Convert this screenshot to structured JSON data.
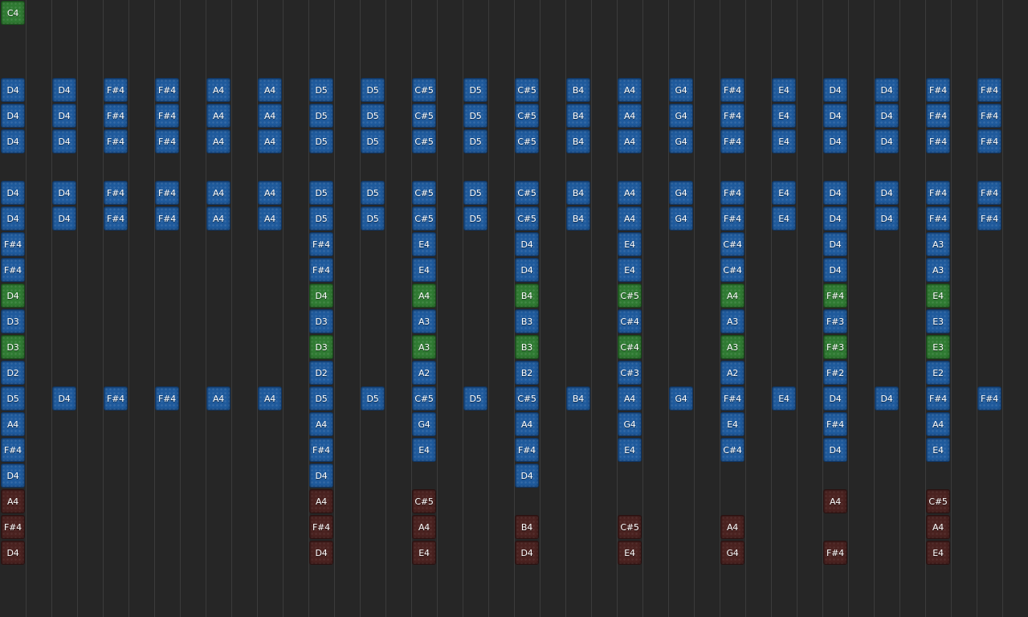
{
  "colors": {
    "background": "#262626",
    "grid_line": "#3b3b3b",
    "blue_note": "#1f5a9c",
    "green_note": "#2f7a32",
    "red_note": "#4a2220",
    "label": "#ffffff"
  },
  "columns": 20,
  "rows": 24,
  "notes": [
    {
      "col": 0,
      "row": 0,
      "label": "C4",
      "color": "green"
    },
    {
      "col": 0,
      "row": 3,
      "label": "D4",
      "color": "blue"
    },
    {
      "col": 1,
      "row": 3,
      "label": "D4",
      "color": "blue"
    },
    {
      "col": 2,
      "row": 3,
      "label": "F#4",
      "color": "blue"
    },
    {
      "col": 3,
      "row": 3,
      "label": "F#4",
      "color": "blue"
    },
    {
      "col": 4,
      "row": 3,
      "label": "A4",
      "color": "blue"
    },
    {
      "col": 5,
      "row": 3,
      "label": "A4",
      "color": "blue"
    },
    {
      "col": 6,
      "row": 3,
      "label": "D5",
      "color": "blue"
    },
    {
      "col": 7,
      "row": 3,
      "label": "D5",
      "color": "blue"
    },
    {
      "col": 8,
      "row": 3,
      "label": "C#5",
      "color": "blue"
    },
    {
      "col": 9,
      "row": 3,
      "label": "D5",
      "color": "blue"
    },
    {
      "col": 10,
      "row": 3,
      "label": "C#5",
      "color": "blue"
    },
    {
      "col": 11,
      "row": 3,
      "label": "B4",
      "color": "blue"
    },
    {
      "col": 12,
      "row": 3,
      "label": "A4",
      "color": "blue"
    },
    {
      "col": 13,
      "row": 3,
      "label": "G4",
      "color": "blue"
    },
    {
      "col": 14,
      "row": 3,
      "label": "F#4",
      "color": "blue"
    },
    {
      "col": 15,
      "row": 3,
      "label": "E4",
      "color": "blue"
    },
    {
      "col": 16,
      "row": 3,
      "label": "D4",
      "color": "blue"
    },
    {
      "col": 17,
      "row": 3,
      "label": "D4",
      "color": "blue"
    },
    {
      "col": 18,
      "row": 3,
      "label": "F#4",
      "color": "blue"
    },
    {
      "col": 19,
      "row": 3,
      "label": "F#4",
      "color": "blue"
    },
    {
      "col": 0,
      "row": 4,
      "label": "D4",
      "color": "blue"
    },
    {
      "col": 1,
      "row": 4,
      "label": "D4",
      "color": "blue"
    },
    {
      "col": 2,
      "row": 4,
      "label": "F#4",
      "color": "blue"
    },
    {
      "col": 3,
      "row": 4,
      "label": "F#4",
      "color": "blue"
    },
    {
      "col": 4,
      "row": 4,
      "label": "A4",
      "color": "blue"
    },
    {
      "col": 5,
      "row": 4,
      "label": "A4",
      "color": "blue"
    },
    {
      "col": 6,
      "row": 4,
      "label": "D5",
      "color": "blue"
    },
    {
      "col": 7,
      "row": 4,
      "label": "D5",
      "color": "blue"
    },
    {
      "col": 8,
      "row": 4,
      "label": "C#5",
      "color": "blue"
    },
    {
      "col": 9,
      "row": 4,
      "label": "D5",
      "color": "blue"
    },
    {
      "col": 10,
      "row": 4,
      "label": "C#5",
      "color": "blue"
    },
    {
      "col": 11,
      "row": 4,
      "label": "B4",
      "color": "blue"
    },
    {
      "col": 12,
      "row": 4,
      "label": "A4",
      "color": "blue"
    },
    {
      "col": 13,
      "row": 4,
      "label": "G4",
      "color": "blue"
    },
    {
      "col": 14,
      "row": 4,
      "label": "F#4",
      "color": "blue"
    },
    {
      "col": 15,
      "row": 4,
      "label": "E4",
      "color": "blue"
    },
    {
      "col": 16,
      "row": 4,
      "label": "D4",
      "color": "blue"
    },
    {
      "col": 17,
      "row": 4,
      "label": "D4",
      "color": "blue"
    },
    {
      "col": 18,
      "row": 4,
      "label": "F#4",
      "color": "blue"
    },
    {
      "col": 19,
      "row": 4,
      "label": "F#4",
      "color": "blue"
    },
    {
      "col": 0,
      "row": 5,
      "label": "D4",
      "color": "blue"
    },
    {
      "col": 1,
      "row": 5,
      "label": "D4",
      "color": "blue"
    },
    {
      "col": 2,
      "row": 5,
      "label": "F#4",
      "color": "blue"
    },
    {
      "col": 3,
      "row": 5,
      "label": "F#4",
      "color": "blue"
    },
    {
      "col": 4,
      "row": 5,
      "label": "A4",
      "color": "blue"
    },
    {
      "col": 5,
      "row": 5,
      "label": "A4",
      "color": "blue"
    },
    {
      "col": 6,
      "row": 5,
      "label": "D5",
      "color": "blue"
    },
    {
      "col": 7,
      "row": 5,
      "label": "D5",
      "color": "blue"
    },
    {
      "col": 8,
      "row": 5,
      "label": "C#5",
      "color": "blue"
    },
    {
      "col": 9,
      "row": 5,
      "label": "D5",
      "color": "blue"
    },
    {
      "col": 10,
      "row": 5,
      "label": "C#5",
      "color": "blue"
    },
    {
      "col": 11,
      "row": 5,
      "label": "B4",
      "color": "blue"
    },
    {
      "col": 12,
      "row": 5,
      "label": "A4",
      "color": "blue"
    },
    {
      "col": 13,
      "row": 5,
      "label": "G4",
      "color": "blue"
    },
    {
      "col": 14,
      "row": 5,
      "label": "F#4",
      "color": "blue"
    },
    {
      "col": 15,
      "row": 5,
      "label": "E4",
      "color": "blue"
    },
    {
      "col": 16,
      "row": 5,
      "label": "D4",
      "color": "blue"
    },
    {
      "col": 17,
      "row": 5,
      "label": "D4",
      "color": "blue"
    },
    {
      "col": 18,
      "row": 5,
      "label": "F#4",
      "color": "blue"
    },
    {
      "col": 19,
      "row": 5,
      "label": "F#4",
      "color": "blue"
    },
    {
      "col": 0,
      "row": 7,
      "label": "D4",
      "color": "blue"
    },
    {
      "col": 1,
      "row": 7,
      "label": "D4",
      "color": "blue"
    },
    {
      "col": 2,
      "row": 7,
      "label": "F#4",
      "color": "blue"
    },
    {
      "col": 3,
      "row": 7,
      "label": "F#4",
      "color": "blue"
    },
    {
      "col": 4,
      "row": 7,
      "label": "A4",
      "color": "blue"
    },
    {
      "col": 5,
      "row": 7,
      "label": "A4",
      "color": "blue"
    },
    {
      "col": 6,
      "row": 7,
      "label": "D5",
      "color": "blue"
    },
    {
      "col": 7,
      "row": 7,
      "label": "D5",
      "color": "blue"
    },
    {
      "col": 8,
      "row": 7,
      "label": "C#5",
      "color": "blue"
    },
    {
      "col": 9,
      "row": 7,
      "label": "D5",
      "color": "blue"
    },
    {
      "col": 10,
      "row": 7,
      "label": "C#5",
      "color": "blue"
    },
    {
      "col": 11,
      "row": 7,
      "label": "B4",
      "color": "blue"
    },
    {
      "col": 12,
      "row": 7,
      "label": "A4",
      "color": "blue"
    },
    {
      "col": 13,
      "row": 7,
      "label": "G4",
      "color": "blue"
    },
    {
      "col": 14,
      "row": 7,
      "label": "F#4",
      "color": "blue"
    },
    {
      "col": 15,
      "row": 7,
      "label": "E4",
      "color": "blue"
    },
    {
      "col": 16,
      "row": 7,
      "label": "D4",
      "color": "blue"
    },
    {
      "col": 17,
      "row": 7,
      "label": "D4",
      "color": "blue"
    },
    {
      "col": 18,
      "row": 7,
      "label": "F#4",
      "color": "blue"
    },
    {
      "col": 19,
      "row": 7,
      "label": "F#4",
      "color": "blue"
    },
    {
      "col": 0,
      "row": 8,
      "label": "D4",
      "color": "blue"
    },
    {
      "col": 1,
      "row": 8,
      "label": "D4",
      "color": "blue"
    },
    {
      "col": 2,
      "row": 8,
      "label": "F#4",
      "color": "blue"
    },
    {
      "col": 3,
      "row": 8,
      "label": "F#4",
      "color": "blue"
    },
    {
      "col": 4,
      "row": 8,
      "label": "A4",
      "color": "blue"
    },
    {
      "col": 5,
      "row": 8,
      "label": "A4",
      "color": "blue"
    },
    {
      "col": 6,
      "row": 8,
      "label": "D5",
      "color": "blue"
    },
    {
      "col": 7,
      "row": 8,
      "label": "D5",
      "color": "blue"
    },
    {
      "col": 8,
      "row": 8,
      "label": "C#5",
      "color": "blue"
    },
    {
      "col": 9,
      "row": 8,
      "label": "D5",
      "color": "blue"
    },
    {
      "col": 10,
      "row": 8,
      "label": "C#5",
      "color": "blue"
    },
    {
      "col": 11,
      "row": 8,
      "label": "B4",
      "color": "blue"
    },
    {
      "col": 12,
      "row": 8,
      "label": "A4",
      "color": "blue"
    },
    {
      "col": 13,
      "row": 8,
      "label": "G4",
      "color": "blue"
    },
    {
      "col": 14,
      "row": 8,
      "label": "F#4",
      "color": "blue"
    },
    {
      "col": 15,
      "row": 8,
      "label": "E4",
      "color": "blue"
    },
    {
      "col": 16,
      "row": 8,
      "label": "D4",
      "color": "blue"
    },
    {
      "col": 17,
      "row": 8,
      "label": "D4",
      "color": "blue"
    },
    {
      "col": 18,
      "row": 8,
      "label": "F#4",
      "color": "blue"
    },
    {
      "col": 19,
      "row": 8,
      "label": "F#4",
      "color": "blue"
    },
    {
      "col": 0,
      "row": 9,
      "label": "F#4",
      "color": "blue"
    },
    {
      "col": 6,
      "row": 9,
      "label": "F#4",
      "color": "blue"
    },
    {
      "col": 8,
      "row": 9,
      "label": "E4",
      "color": "blue"
    },
    {
      "col": 10,
      "row": 9,
      "label": "D4",
      "color": "blue"
    },
    {
      "col": 12,
      "row": 9,
      "label": "E4",
      "color": "blue"
    },
    {
      "col": 14,
      "row": 9,
      "label": "C#4",
      "color": "blue"
    },
    {
      "col": 16,
      "row": 9,
      "label": "D4",
      "color": "blue"
    },
    {
      "col": 18,
      "row": 9,
      "label": "A3",
      "color": "blue"
    },
    {
      "col": 0,
      "row": 10,
      "label": "F#4",
      "color": "blue"
    },
    {
      "col": 6,
      "row": 10,
      "label": "F#4",
      "color": "blue"
    },
    {
      "col": 8,
      "row": 10,
      "label": "E4",
      "color": "blue"
    },
    {
      "col": 10,
      "row": 10,
      "label": "D4",
      "color": "blue"
    },
    {
      "col": 12,
      "row": 10,
      "label": "E4",
      "color": "blue"
    },
    {
      "col": 14,
      "row": 10,
      "label": "C#4",
      "color": "blue"
    },
    {
      "col": 16,
      "row": 10,
      "label": "D4",
      "color": "blue"
    },
    {
      "col": 18,
      "row": 10,
      "label": "A3",
      "color": "blue"
    },
    {
      "col": 0,
      "row": 11,
      "label": "D4",
      "color": "green"
    },
    {
      "col": 6,
      "row": 11,
      "label": "D4",
      "color": "green"
    },
    {
      "col": 8,
      "row": 11,
      "label": "A4",
      "color": "green"
    },
    {
      "col": 10,
      "row": 11,
      "label": "B4",
      "color": "green"
    },
    {
      "col": 12,
      "row": 11,
      "label": "C#5",
      "color": "green"
    },
    {
      "col": 14,
      "row": 11,
      "label": "A4",
      "color": "green"
    },
    {
      "col": 16,
      "row": 11,
      "label": "F#4",
      "color": "green"
    },
    {
      "col": 18,
      "row": 11,
      "label": "E4",
      "color": "green"
    },
    {
      "col": 0,
      "row": 12,
      "label": "D3",
      "color": "blue"
    },
    {
      "col": 6,
      "row": 12,
      "label": "D3",
      "color": "blue"
    },
    {
      "col": 8,
      "row": 12,
      "label": "A3",
      "color": "blue"
    },
    {
      "col": 10,
      "row": 12,
      "label": "B3",
      "color": "blue"
    },
    {
      "col": 12,
      "row": 12,
      "label": "C#4",
      "color": "blue"
    },
    {
      "col": 14,
      "row": 12,
      "label": "A3",
      "color": "blue"
    },
    {
      "col": 16,
      "row": 12,
      "label": "F#3",
      "color": "blue"
    },
    {
      "col": 18,
      "row": 12,
      "label": "E3",
      "color": "blue"
    },
    {
      "col": 0,
      "row": 13,
      "label": "D3",
      "color": "green"
    },
    {
      "col": 6,
      "row": 13,
      "label": "D3",
      "color": "green"
    },
    {
      "col": 8,
      "row": 13,
      "label": "A3",
      "color": "green"
    },
    {
      "col": 10,
      "row": 13,
      "label": "B3",
      "color": "green"
    },
    {
      "col": 12,
      "row": 13,
      "label": "C#4",
      "color": "green"
    },
    {
      "col": 14,
      "row": 13,
      "label": "A3",
      "color": "green"
    },
    {
      "col": 16,
      "row": 13,
      "label": "F#3",
      "color": "green"
    },
    {
      "col": 18,
      "row": 13,
      "label": "E3",
      "color": "green"
    },
    {
      "col": 0,
      "row": 14,
      "label": "D2",
      "color": "blue"
    },
    {
      "col": 6,
      "row": 14,
      "label": "D2",
      "color": "blue"
    },
    {
      "col": 8,
      "row": 14,
      "label": "A2",
      "color": "blue"
    },
    {
      "col": 10,
      "row": 14,
      "label": "B2",
      "color": "blue"
    },
    {
      "col": 12,
      "row": 14,
      "label": "C#3",
      "color": "blue"
    },
    {
      "col": 14,
      "row": 14,
      "label": "A2",
      "color": "blue"
    },
    {
      "col": 16,
      "row": 14,
      "label": "F#2",
      "color": "blue"
    },
    {
      "col": 18,
      "row": 14,
      "label": "E2",
      "color": "blue"
    },
    {
      "col": 0,
      "row": 15,
      "label": "D5",
      "color": "blue"
    },
    {
      "col": 1,
      "row": 15,
      "label": "D4",
      "color": "blue"
    },
    {
      "col": 2,
      "row": 15,
      "label": "F#4",
      "color": "blue"
    },
    {
      "col": 3,
      "row": 15,
      "label": "F#4",
      "color": "blue"
    },
    {
      "col": 4,
      "row": 15,
      "label": "A4",
      "color": "blue"
    },
    {
      "col": 5,
      "row": 15,
      "label": "A4",
      "color": "blue"
    },
    {
      "col": 6,
      "row": 15,
      "label": "D5",
      "color": "blue"
    },
    {
      "col": 7,
      "row": 15,
      "label": "D5",
      "color": "blue"
    },
    {
      "col": 8,
      "row": 15,
      "label": "C#5",
      "color": "blue"
    },
    {
      "col": 9,
      "row": 15,
      "label": "D5",
      "color": "blue"
    },
    {
      "col": 10,
      "row": 15,
      "label": "C#5",
      "color": "blue"
    },
    {
      "col": 11,
      "row": 15,
      "label": "B4",
      "color": "blue"
    },
    {
      "col": 12,
      "row": 15,
      "label": "A4",
      "color": "blue"
    },
    {
      "col": 13,
      "row": 15,
      "label": "G4",
      "color": "blue"
    },
    {
      "col": 14,
      "row": 15,
      "label": "F#4",
      "color": "blue"
    },
    {
      "col": 15,
      "row": 15,
      "label": "E4",
      "color": "blue"
    },
    {
      "col": 16,
      "row": 15,
      "label": "D4",
      "color": "blue"
    },
    {
      "col": 17,
      "row": 15,
      "label": "D4",
      "color": "blue"
    },
    {
      "col": 18,
      "row": 15,
      "label": "F#4",
      "color": "blue"
    },
    {
      "col": 19,
      "row": 15,
      "label": "F#4",
      "color": "blue"
    },
    {
      "col": 0,
      "row": 16,
      "label": "A4",
      "color": "blue"
    },
    {
      "col": 6,
      "row": 16,
      "label": "A4",
      "color": "blue"
    },
    {
      "col": 8,
      "row": 16,
      "label": "G4",
      "color": "blue"
    },
    {
      "col": 10,
      "row": 16,
      "label": "A4",
      "color": "blue"
    },
    {
      "col": 12,
      "row": 16,
      "label": "G4",
      "color": "blue"
    },
    {
      "col": 14,
      "row": 16,
      "label": "E4",
      "color": "blue"
    },
    {
      "col": 16,
      "row": 16,
      "label": "F#4",
      "color": "blue"
    },
    {
      "col": 18,
      "row": 16,
      "label": "A4",
      "color": "blue"
    },
    {
      "col": 0,
      "row": 17,
      "label": "F#4",
      "color": "blue"
    },
    {
      "col": 6,
      "row": 17,
      "label": "F#4",
      "color": "blue"
    },
    {
      "col": 8,
      "row": 17,
      "label": "E4",
      "color": "blue"
    },
    {
      "col": 10,
      "row": 17,
      "label": "F#4",
      "color": "blue"
    },
    {
      "col": 12,
      "row": 17,
      "label": "E4",
      "color": "blue"
    },
    {
      "col": 14,
      "row": 17,
      "label": "C#4",
      "color": "blue"
    },
    {
      "col": 16,
      "row": 17,
      "label": "D4",
      "color": "blue"
    },
    {
      "col": 18,
      "row": 17,
      "label": "E4",
      "color": "blue"
    },
    {
      "col": 0,
      "row": 18,
      "label": "D4",
      "color": "blue"
    },
    {
      "col": 6,
      "row": 18,
      "label": "D4",
      "color": "blue"
    },
    {
      "col": 10,
      "row": 18,
      "label": "D4",
      "color": "blue"
    },
    {
      "col": 0,
      "row": 19,
      "label": "A4",
      "color": "red"
    },
    {
      "col": 6,
      "row": 19,
      "label": "A4",
      "color": "red"
    },
    {
      "col": 8,
      "row": 19,
      "label": "C#5",
      "color": "red"
    },
    {
      "col": 16,
      "row": 19,
      "label": "A4",
      "color": "red"
    },
    {
      "col": 18,
      "row": 19,
      "label": "C#5",
      "color": "red"
    },
    {
      "col": 0,
      "row": 20,
      "label": "F#4",
      "color": "red"
    },
    {
      "col": 6,
      "row": 20,
      "label": "F#4",
      "color": "red"
    },
    {
      "col": 8,
      "row": 20,
      "label": "A4",
      "color": "red"
    },
    {
      "col": 10,
      "row": 20,
      "label": "B4",
      "color": "red"
    },
    {
      "col": 12,
      "row": 20,
      "label": "C#5",
      "color": "red"
    },
    {
      "col": 14,
      "row": 20,
      "label": "A4",
      "color": "red"
    },
    {
      "col": 18,
      "row": 20,
      "label": "A4",
      "color": "red"
    },
    {
      "col": 0,
      "row": 21,
      "label": "D4",
      "color": "red"
    },
    {
      "col": 6,
      "row": 21,
      "label": "D4",
      "color": "red"
    },
    {
      "col": 8,
      "row": 21,
      "label": "E4",
      "color": "red"
    },
    {
      "col": 10,
      "row": 21,
      "label": "D4",
      "color": "red"
    },
    {
      "col": 12,
      "row": 21,
      "label": "E4",
      "color": "red"
    },
    {
      "col": 14,
      "row": 21,
      "label": "G4",
      "color": "red"
    },
    {
      "col": 16,
      "row": 21,
      "label": "F#4",
      "color": "red"
    },
    {
      "col": 18,
      "row": 21,
      "label": "E4",
      "color": "red"
    }
  ]
}
